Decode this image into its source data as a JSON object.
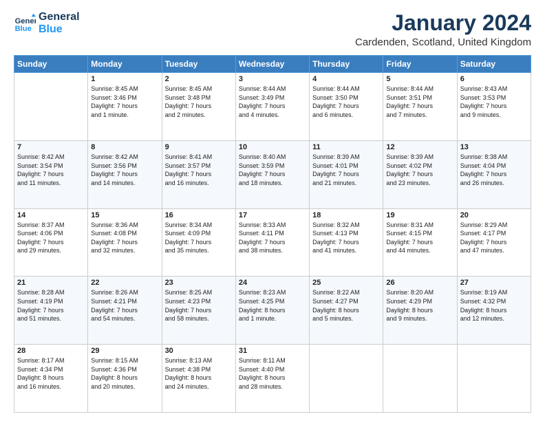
{
  "header": {
    "logo_line1": "General",
    "logo_line2": "Blue",
    "month": "January 2024",
    "location": "Cardenden, Scotland, United Kingdom"
  },
  "days_of_week": [
    "Sunday",
    "Monday",
    "Tuesday",
    "Wednesday",
    "Thursday",
    "Friday",
    "Saturday"
  ],
  "weeks": [
    [
      {
        "day": "",
        "content": ""
      },
      {
        "day": "1",
        "content": "Sunrise: 8:45 AM\nSunset: 3:46 PM\nDaylight: 7 hours\nand 1 minute."
      },
      {
        "day": "2",
        "content": "Sunrise: 8:45 AM\nSunset: 3:48 PM\nDaylight: 7 hours\nand 2 minutes."
      },
      {
        "day": "3",
        "content": "Sunrise: 8:44 AM\nSunset: 3:49 PM\nDaylight: 7 hours\nand 4 minutes."
      },
      {
        "day": "4",
        "content": "Sunrise: 8:44 AM\nSunset: 3:50 PM\nDaylight: 7 hours\nand 6 minutes."
      },
      {
        "day": "5",
        "content": "Sunrise: 8:44 AM\nSunset: 3:51 PM\nDaylight: 7 hours\nand 7 minutes."
      },
      {
        "day": "6",
        "content": "Sunrise: 8:43 AM\nSunset: 3:53 PM\nDaylight: 7 hours\nand 9 minutes."
      }
    ],
    [
      {
        "day": "7",
        "content": "Sunrise: 8:42 AM\nSunset: 3:54 PM\nDaylight: 7 hours\nand 11 minutes."
      },
      {
        "day": "8",
        "content": "Sunrise: 8:42 AM\nSunset: 3:56 PM\nDaylight: 7 hours\nand 14 minutes."
      },
      {
        "day": "9",
        "content": "Sunrise: 8:41 AM\nSunset: 3:57 PM\nDaylight: 7 hours\nand 16 minutes."
      },
      {
        "day": "10",
        "content": "Sunrise: 8:40 AM\nSunset: 3:59 PM\nDaylight: 7 hours\nand 18 minutes."
      },
      {
        "day": "11",
        "content": "Sunrise: 8:39 AM\nSunset: 4:01 PM\nDaylight: 7 hours\nand 21 minutes."
      },
      {
        "day": "12",
        "content": "Sunrise: 8:39 AM\nSunset: 4:02 PM\nDaylight: 7 hours\nand 23 minutes."
      },
      {
        "day": "13",
        "content": "Sunrise: 8:38 AM\nSunset: 4:04 PM\nDaylight: 7 hours\nand 26 minutes."
      }
    ],
    [
      {
        "day": "14",
        "content": "Sunrise: 8:37 AM\nSunset: 4:06 PM\nDaylight: 7 hours\nand 29 minutes."
      },
      {
        "day": "15",
        "content": "Sunrise: 8:36 AM\nSunset: 4:08 PM\nDaylight: 7 hours\nand 32 minutes."
      },
      {
        "day": "16",
        "content": "Sunrise: 8:34 AM\nSunset: 4:09 PM\nDaylight: 7 hours\nand 35 minutes."
      },
      {
        "day": "17",
        "content": "Sunrise: 8:33 AM\nSunset: 4:11 PM\nDaylight: 7 hours\nand 38 minutes."
      },
      {
        "day": "18",
        "content": "Sunrise: 8:32 AM\nSunset: 4:13 PM\nDaylight: 7 hours\nand 41 minutes."
      },
      {
        "day": "19",
        "content": "Sunrise: 8:31 AM\nSunset: 4:15 PM\nDaylight: 7 hours\nand 44 minutes."
      },
      {
        "day": "20",
        "content": "Sunrise: 8:29 AM\nSunset: 4:17 PM\nDaylight: 7 hours\nand 47 minutes."
      }
    ],
    [
      {
        "day": "21",
        "content": "Sunrise: 8:28 AM\nSunset: 4:19 PM\nDaylight: 7 hours\nand 51 minutes."
      },
      {
        "day": "22",
        "content": "Sunrise: 8:26 AM\nSunset: 4:21 PM\nDaylight: 7 hours\nand 54 minutes."
      },
      {
        "day": "23",
        "content": "Sunrise: 8:25 AM\nSunset: 4:23 PM\nDaylight: 7 hours\nand 58 minutes."
      },
      {
        "day": "24",
        "content": "Sunrise: 8:23 AM\nSunset: 4:25 PM\nDaylight: 8 hours\nand 1 minute."
      },
      {
        "day": "25",
        "content": "Sunrise: 8:22 AM\nSunset: 4:27 PM\nDaylight: 8 hours\nand 5 minutes."
      },
      {
        "day": "26",
        "content": "Sunrise: 8:20 AM\nSunset: 4:29 PM\nDaylight: 8 hours\nand 9 minutes."
      },
      {
        "day": "27",
        "content": "Sunrise: 8:19 AM\nSunset: 4:32 PM\nDaylight: 8 hours\nand 12 minutes."
      }
    ],
    [
      {
        "day": "28",
        "content": "Sunrise: 8:17 AM\nSunset: 4:34 PM\nDaylight: 8 hours\nand 16 minutes."
      },
      {
        "day": "29",
        "content": "Sunrise: 8:15 AM\nSunset: 4:36 PM\nDaylight: 8 hours\nand 20 minutes."
      },
      {
        "day": "30",
        "content": "Sunrise: 8:13 AM\nSunset: 4:38 PM\nDaylight: 8 hours\nand 24 minutes."
      },
      {
        "day": "31",
        "content": "Sunrise: 8:11 AM\nSunset: 4:40 PM\nDaylight: 8 hours\nand 28 minutes."
      },
      {
        "day": "",
        "content": ""
      },
      {
        "day": "",
        "content": ""
      },
      {
        "day": "",
        "content": ""
      }
    ]
  ]
}
